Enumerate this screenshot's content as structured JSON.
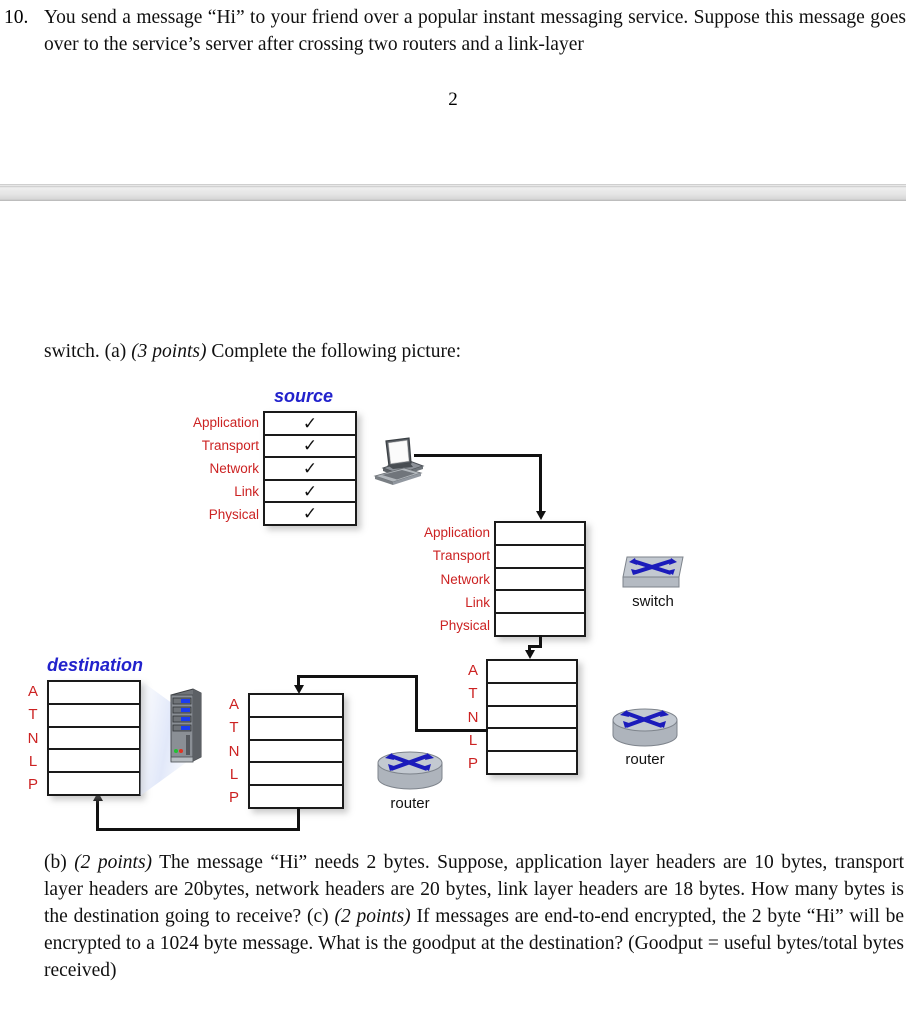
{
  "question": {
    "number": "10.",
    "text": "You send a message “Hi” to your friend over a popular instant messaging service. Suppose this message goes over to the service’s server after crossing two routers and a link-layer",
    "page_number": "2",
    "continuation": "switch. (a) ",
    "part_a_points": "(3 points)",
    "part_a_text": " Complete the following picture:",
    "part_b_label": "(b) ",
    "part_b_points": "(2 points)",
    "part_b_text_1": " The message “Hi” needs 2 bytes. Suppose, application layer headers are 10 bytes, transport layer headers are 20bytes, network headers are 20 bytes, link layer headers are 18 bytes. How many bytes is the destination going to receive? ",
    "part_c_label": "(c) ",
    "part_c_points": "(2 points)",
    "part_c_text": " If messages are end-to-end encrypted, the 2 byte “Hi” will be encrypted to a 1024 byte message. What is the goodput at the destination? (Goodput = useful bytes/total bytes received)"
  },
  "figure": {
    "source_title": "source",
    "destination_title": "destination",
    "source_stack": {
      "labels": [
        "Application",
        "Transport",
        "Network",
        "Link",
        "Physical"
      ],
      "cells": [
        "✓",
        "✓",
        "✓",
        "✓",
        "✓"
      ]
    },
    "server_stack": {
      "labels": [
        "Application",
        "Transport",
        "Network",
        "Link",
        "Physical"
      ],
      "cells": [
        "",
        "",
        "",
        "",
        ""
      ]
    },
    "router_stack_right": {
      "labels": [
        "A",
        "T",
        "N",
        "L",
        "P"
      ],
      "cells": [
        "",
        "",
        "",
        "",
        ""
      ]
    },
    "router_stack_mid": {
      "labels": [
        "A",
        "T",
        "N",
        "L",
        "P"
      ],
      "cells": [
        "",
        "",
        "",
        "",
        ""
      ]
    },
    "destination_stack": {
      "labels": [
        "A",
        "T",
        "N",
        "L",
        "P"
      ],
      "cells": [
        "",
        "",
        "",
        "",
        ""
      ]
    },
    "devices": {
      "laptop": "laptop-icon",
      "switch_caption": "switch",
      "router_right_caption": "router",
      "router_mid_caption": "router",
      "server": "server-tower-icon"
    },
    "colors": {
      "label_red": "#cc2222",
      "title_blue": "#2222cc",
      "line_black": "#111111",
      "device_gray": "#b9bfc8",
      "device_blue": "#1b1bbb"
    }
  }
}
